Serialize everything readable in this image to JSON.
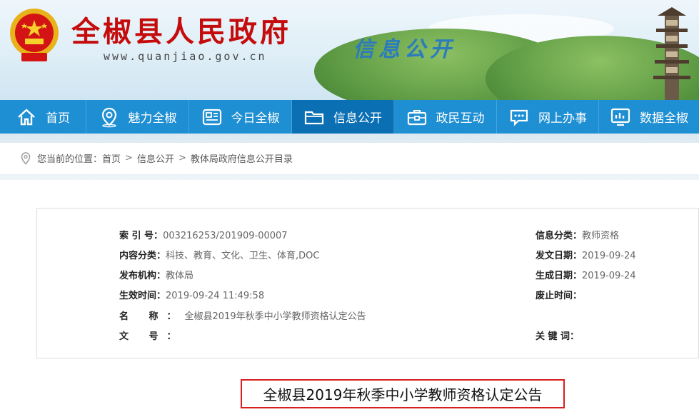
{
  "header": {
    "site_title": "全椒县人民政府",
    "site_url": "www.quanjiao.gov.cn",
    "section_badge": "信息公开"
  },
  "nav": [
    {
      "label": "首页",
      "icon": "home-icon",
      "active": false
    },
    {
      "label": "魅力全椒",
      "icon": "location-pin-icon",
      "active": false
    },
    {
      "label": "今日全椒",
      "icon": "news-icon",
      "active": false
    },
    {
      "label": "信息公开",
      "icon": "folder-icon",
      "active": true
    },
    {
      "label": "政民互动",
      "icon": "briefcase-icon",
      "active": false
    },
    {
      "label": "网上办事",
      "icon": "chat-icon",
      "active": false
    },
    {
      "label": "数据全椒",
      "icon": "data-chart-icon",
      "active": false
    }
  ],
  "breadcrumb": {
    "prefix": "您当前的位置：",
    "items": [
      "首页",
      "信息公开",
      "教体局政府信息公开目录"
    ]
  },
  "info": {
    "index_label": "索 引 号：",
    "index_value": "003216253/201909-00007",
    "content_cat_label": "内容分类：",
    "content_cat_value": "科技、教育、文化、卫生、体育,DOC",
    "publisher_label": "发布机构：",
    "publisher_value": "教体局",
    "effective_label": "生效时间：",
    "effective_value": "2019-09-24 11:49:58",
    "name_label": "名 称：",
    "name_value": "全椒县2019年秋季中小学教师资格认定公告",
    "doc_no_label": "文 号：",
    "doc_no_value": "",
    "info_cat_label": "信息分类：",
    "info_cat_value": "教师资格",
    "issue_date_label": "发文日期：",
    "issue_date_value": "2019-09-24",
    "gen_date_label": "生成日期：",
    "gen_date_value": "2019-09-24",
    "expire_label": "废止时间：",
    "expire_value": "",
    "keywords_label": "关 键 词：",
    "keywords_value": ""
  },
  "article": {
    "title": "全椒县2019年秋季中小学教师资格认定公告"
  },
  "colors": {
    "nav_bg": "#1e8fd3",
    "nav_active": "#0a6fb3",
    "title_red": "#c40c0c",
    "badge_blue": "#2c7bbd",
    "title_border": "#d81e1e"
  }
}
